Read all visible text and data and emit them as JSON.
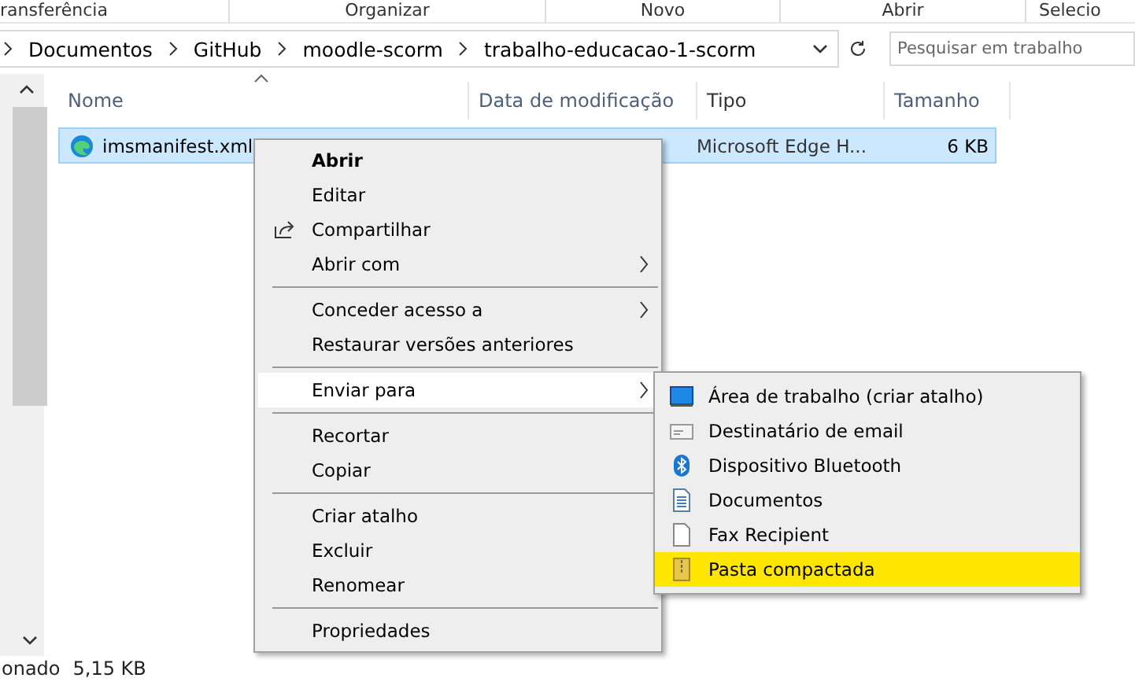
{
  "ribbon": {
    "groups": [
      "ransferência",
      "Organizar",
      "Novo",
      "Abrir",
      "Selecio"
    ]
  },
  "address_bar": {
    "crumbs": [
      "Documentos",
      "GitHub",
      "moodle-scorm",
      "trabalho-educacao-1-scorm"
    ]
  },
  "search": {
    "placeholder": "Pesquisar em trabalho"
  },
  "file_list": {
    "columns": [
      "Nome",
      "Data de modificação",
      "Tipo",
      "Tamanho"
    ],
    "rows": [
      {
        "name": "imsmanifest.xml",
        "type": "Microsoft Edge H...",
        "size": "6 KB",
        "selected": true
      }
    ]
  },
  "context_menu": {
    "groups": [
      [
        {
          "label": "Abrir",
          "bold": true,
          "kind": "plain",
          "submenu": false,
          "selected": false
        },
        {
          "label": "Editar",
          "bold": false,
          "kind": "plain",
          "submenu": false,
          "selected": false
        },
        {
          "label": "Compartilhar",
          "bold": false,
          "kind": "share",
          "submenu": false,
          "selected": false
        },
        {
          "label": "Abrir com",
          "bold": false,
          "kind": "plain",
          "submenu": true,
          "selected": false
        }
      ],
      [
        {
          "label": "Conceder acesso a",
          "bold": false,
          "kind": "plain",
          "submenu": true,
          "selected": false
        },
        {
          "label": "Restaurar versões anteriores",
          "bold": false,
          "kind": "plain",
          "submenu": false,
          "selected": false
        }
      ],
      [
        {
          "label": "Enviar para",
          "bold": false,
          "kind": "plain",
          "submenu": true,
          "selected": true
        }
      ],
      [
        {
          "label": "Recortar",
          "bold": false,
          "kind": "plain",
          "submenu": false,
          "selected": false
        },
        {
          "label": "Copiar",
          "bold": false,
          "kind": "plain",
          "submenu": false,
          "selected": false
        }
      ],
      [
        {
          "label": "Criar atalho",
          "bold": false,
          "kind": "plain",
          "submenu": false,
          "selected": false
        },
        {
          "label": "Excluir",
          "bold": false,
          "kind": "plain",
          "submenu": false,
          "selected": false
        },
        {
          "label": "Renomear",
          "bold": false,
          "kind": "plain",
          "submenu": false,
          "selected": false
        }
      ],
      [
        {
          "label": "Propriedades",
          "bold": false,
          "kind": "plain",
          "submenu": false,
          "selected": false
        }
      ]
    ]
  },
  "send_to_menu": {
    "items": [
      {
        "label": "Área de trabalho (criar atalho)",
        "kind": "desktop",
        "highlighted": false
      },
      {
        "label": "Destinatário de email",
        "kind": "mail",
        "highlighted": false
      },
      {
        "label": "Dispositivo Bluetooth",
        "kind": "bluetooth",
        "highlighted": false
      },
      {
        "label": "Documentos",
        "kind": "documents",
        "highlighted": false
      },
      {
        "label": "Fax Recipient",
        "kind": "fax",
        "highlighted": false
      },
      {
        "label": "Pasta compactada",
        "kind": "zip",
        "highlighted": true
      }
    ]
  },
  "status_bar": {
    "texts": [
      "onado",
      "5,15 KB"
    ]
  }
}
